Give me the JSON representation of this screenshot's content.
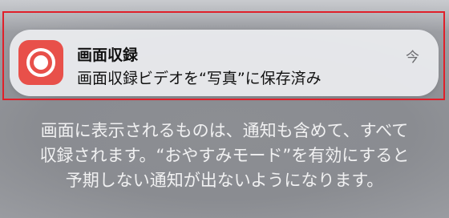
{
  "notification": {
    "app_title": "画面収録",
    "message": "画面収録ビデオを“写真”に保存済み",
    "time": "今"
  },
  "info": {
    "text": "画面に表示されるものは、通知も含めて、すべて収録されます。“おやすみモード”を有効にすると予期しない通知が出ないようになります。"
  },
  "colors": {
    "app_icon_background": "#e8504a",
    "highlight_border": "#e0202a"
  },
  "icons": {
    "app_icon": "screen-recording-icon"
  }
}
